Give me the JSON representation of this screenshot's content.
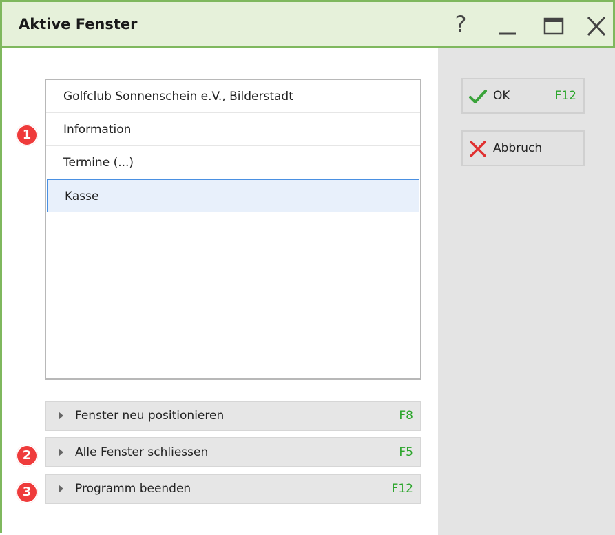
{
  "window": {
    "title": "Aktive Fenster",
    "help": "?"
  },
  "list": {
    "items": [
      "Golfclub Sonnenschein e.V., Bilderstadt",
      "Information",
      "Termine (...)",
      "Kasse"
    ],
    "selected_index": 3
  },
  "actions": [
    {
      "label": "Fenster neu positionieren",
      "key": "F8"
    },
    {
      "label": "Alle Fenster schliessen",
      "key": "F5"
    },
    {
      "label": "Programm beenden",
      "key": "F12"
    }
  ],
  "buttons": {
    "ok": {
      "label": "OK",
      "key": "F12",
      "icon": "check-icon",
      "color": "#3aa33a"
    },
    "cancel": {
      "label": "Abbruch",
      "icon": "x-icon",
      "color": "#e03030"
    }
  },
  "badges": [
    "1",
    "2",
    "3"
  ],
  "colors": {
    "accent": "#7fb85e",
    "title_bg": "#e6f1da",
    "badge": "#ef3b3b",
    "key_green": "#2aa52a"
  }
}
